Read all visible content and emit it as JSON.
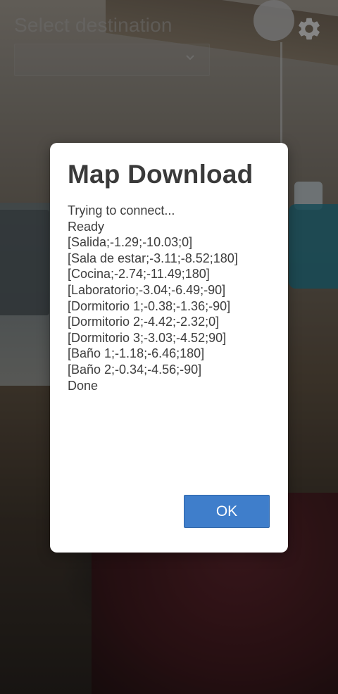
{
  "destination": {
    "label": "Select destination",
    "selected_value": ""
  },
  "icons": {
    "settings": "gear-icon",
    "dropdown": "chevron-down-icon"
  },
  "dialog": {
    "title": "Map Download",
    "log": [
      "Trying to connect...",
      "Ready",
      "[Salida;-1.29;-10.03;0]",
      "[Sala de estar;-3.11;-8.52;180]",
      "[Cocina;-2.74;-11.49;180]",
      "[Laboratorio;-3.04;-6.49;-90]",
      "[Dormitorio 1;-0.38;-1.36;-90]",
      "[Dormitorio 2;-4.42;-2.32;0]",
      "[Dormitorio 3;-3.03;-4.52;90]",
      "[Baño 1;-1.18;-6.46;180]",
      "[Baño 2;-0.34;-4.56;-90]",
      "Done"
    ],
    "ok_label": "OK"
  },
  "colors": {
    "accent": "#3f7ecb",
    "dialog_bg": "#ffffff",
    "text": "#3d3d3d"
  }
}
